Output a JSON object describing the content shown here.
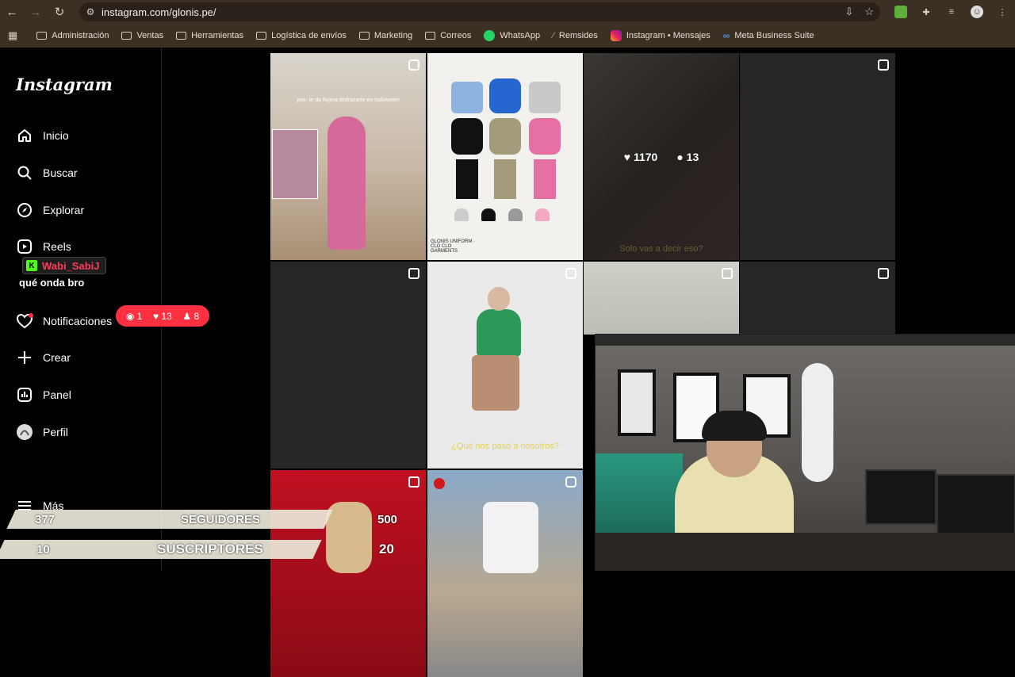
{
  "browser": {
    "url": "instagram.com/glonis.pe/",
    "bookmarks": [
      "Administración",
      "Ventas",
      "Herramientas",
      "Logística de envíos",
      "Marketing",
      "Correos",
      "WhatsApp",
      "Remsides",
      "Instagram • Mensajes",
      "Meta Business Suite"
    ]
  },
  "sidebar": {
    "logo": "Instagram",
    "items": [
      {
        "label": "Inicio",
        "icon": "home-icon"
      },
      {
        "label": "Buscar",
        "icon": "search-icon"
      },
      {
        "label": "Explorar",
        "icon": "explore-icon"
      },
      {
        "label": "Reels",
        "icon": "reels-icon"
      },
      {
        "label": "Notificaciones",
        "icon": "heart-icon"
      },
      {
        "label": "Crear",
        "icon": "plus-icon"
      },
      {
        "label": "Panel",
        "icon": "dashboard-icon"
      },
      {
        "label": "Perfil",
        "icon": "profile-icon"
      },
      {
        "label": "Más",
        "icon": "menu-icon"
      }
    ]
  },
  "notifications": {
    "comments": "1",
    "likes": "13",
    "follows": "8"
  },
  "grid": {
    "tile1_caption": "pov: te da flojera disfrazarte en halloween",
    "tile2_caption": "GLONIS UNIFORM · CLO CLO GARMENTS",
    "tile3_caption": "Solo vas a decir eso?",
    "tile3_likes": "1170",
    "tile3_comments": "13",
    "tile6_caption": "¿Qué nos pasó a nosotros?"
  },
  "stream": {
    "chat_user": "Wabi_SabiJ",
    "chat_message": "qué onda bro",
    "followers_current": "377",
    "followers_label": "SEGUIDORES",
    "followers_goal": "500",
    "followers_progress": 0.754,
    "subs_current": "10",
    "subs_label": "SUSCRIPTORES",
    "subs_goal": "20",
    "subs_progress": 0.5
  },
  "colors": {
    "accent": "#ff3040",
    "chrome": "#3c3025",
    "tile": "#262626"
  }
}
